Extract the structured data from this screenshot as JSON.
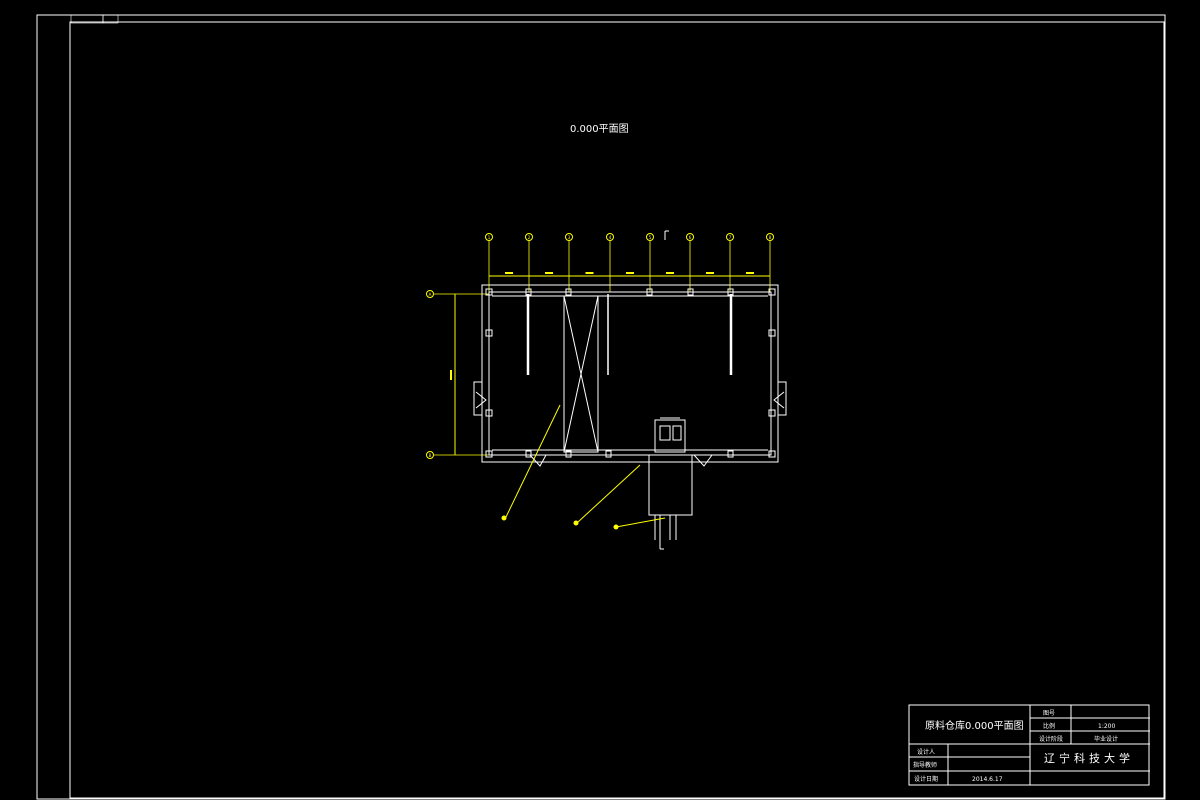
{
  "top_tag": {
    "code": "",
    "label": ""
  },
  "drawing_title": "0.000平面图",
  "axis_labels": [
    "1",
    "2",
    "3",
    "4",
    "5",
    "6",
    "7",
    "8"
  ],
  "row_axis_labels": [
    "A",
    "B"
  ],
  "section_mark": "",
  "room_labels": [
    "",
    "",
    "",
    ""
  ],
  "title_block": {
    "drawing_name": "原料仓库0.000平面图",
    "drawing_no_label": "图号",
    "drawing_no": "",
    "scale_label": "比例",
    "scale": "1:200",
    "stage_label": "设计阶段",
    "stage": "毕业设计",
    "designer_label": "设计人",
    "designer": "",
    "advisor_label": "指导教师",
    "advisor": "",
    "date_label": "设计日期",
    "date": "2014.6.17",
    "school": "辽宁科技大学",
    "project": ""
  },
  "colors": {
    "line": "#ffffff",
    "axis": "#ffff00",
    "bg": "#000000"
  }
}
